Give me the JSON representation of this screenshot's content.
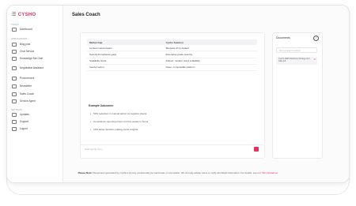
{
  "sidebar": {
    "logo": "CYSHO",
    "sections": [
      "Tools",
      "Applications",
      "Settings"
    ],
    "tools": [
      {
        "label": "Dashboard",
        "icon": "dashboard-icon"
      }
    ],
    "applications": [
      {
        "label": "Blog post",
        "icon": "blog-icon"
      },
      {
        "label": "Chat Service",
        "icon": "chat-icon"
      },
      {
        "label": "Knowledge Bot Chat",
        "icon": "bot-icon"
      },
      {
        "label": "Negotiation Assistant",
        "icon": "handshake-icon"
      },
      {
        "label": "Procurement",
        "icon": "cart-icon"
      },
      {
        "label": "Newsletter",
        "icon": "newsletter-icon"
      },
      {
        "label": "Sales Coach",
        "icon": "coach-icon"
      },
      {
        "label": "Service Agent",
        "icon": "agent-icon"
      }
    ],
    "settings": [
      {
        "label": "Updates",
        "icon": "updates-icon"
      },
      {
        "label": "Support",
        "icon": "support-icon"
      },
      {
        "label": "Logout",
        "icon": "logout-icon"
      }
    ]
  },
  "main": {
    "title": "Sales Coach",
    "table": {
      "headers": [
        "Market Gap",
        "Cysho Solution"
      ],
      "rows": [
        [
          "Limited customization",
          "Bespoke AI by default"
        ],
        [
          "Security/compliance gaps",
          "Enterprise-grade security"
        ],
        [
          "Scalability limits",
          "Robust, modern cloud scalability"
        ],
        [
          "Vendor lock-in",
          "Open, composable platform"
        ]
      ]
    },
    "outcomes_title": "Example Outcomes:",
    "outcomes": [
      "50% reduction in manual admin for logistics clients",
      "Compliance reporting times cut from weeks to hours",
      "10% faster decision-making via AI insights"
    ],
    "prompt_placeholder": "Start typing here..."
  },
  "documents": {
    "title": "Documents",
    "drop_placeholder": "Drop or select to upload",
    "file_name": "Cysho DEB Marketing Strategy and Sale.pdf"
  },
  "footer": {
    "label": "Please Note:",
    "text": "Responses generated by Cysho's AI may occasionally be inaccurate or incomplete. We strongly advise users to verify all critical information. For details, see our",
    "link": "T&C Disclaimer"
  },
  "colors": {
    "accent": "#e8305a"
  }
}
